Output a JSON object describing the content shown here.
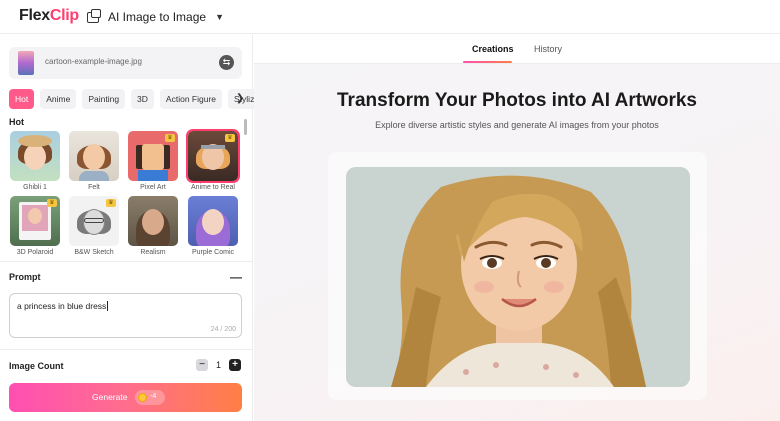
{
  "app": {
    "logo_prefix": "Flex",
    "logo_suffix": "Clip",
    "tool_name": "AI Image to Image"
  },
  "upload": {
    "file_name": "cartoon-example-image.jpg"
  },
  "categories": [
    "Hot",
    "Anime",
    "Painting",
    "3D",
    "Action Figure",
    "Stylize"
  ],
  "active_category": "Hot",
  "styles_section": "Hot",
  "styles": [
    {
      "label": "Ghibli 1",
      "premium": false,
      "selected": false
    },
    {
      "label": "Felt",
      "premium": false,
      "selected": false
    },
    {
      "label": "Pixel Art",
      "premium": true,
      "selected": false
    },
    {
      "label": "Anime to Real",
      "premium": true,
      "selected": true
    },
    {
      "label": "3D Polaroid",
      "premium": true,
      "selected": false
    },
    {
      "label": "B&W Sketch",
      "premium": true,
      "selected": false
    },
    {
      "label": "Realism",
      "premium": false,
      "selected": false
    },
    {
      "label": "Purple Comic",
      "premium": false,
      "selected": false
    }
  ],
  "prompt": {
    "label": "Prompt",
    "value": "a princess in blue dress",
    "counter": "24 / 200"
  },
  "image_count": {
    "label": "Image Count",
    "value": "1"
  },
  "generate": {
    "label": "Generate",
    "cost": "-4"
  },
  "result_tabs": [
    "Creations",
    "History"
  ],
  "active_result_tab": "Creations",
  "hero": {
    "title": "Transform Your Photos into AI Artworks",
    "subtitle": "Explore diverse artistic styles and generate AI images from your photos"
  },
  "colors": {
    "accent_pink": "#ff3d6e",
    "gradient_start": "#ff4fb3",
    "gradient_end": "#ff7e45"
  }
}
